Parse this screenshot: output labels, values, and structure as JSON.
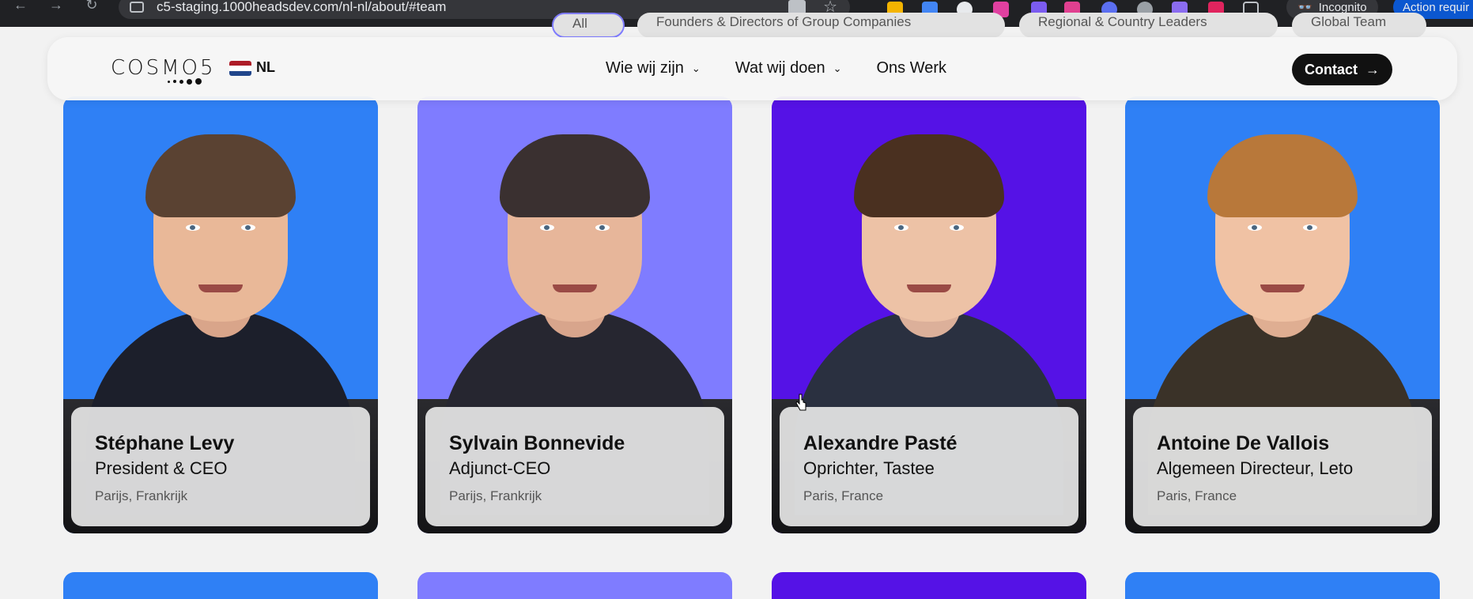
{
  "browser": {
    "url": "c5-staging.1000headsdev.com/nl-nl/about/#team",
    "incognito_label": "Incognito",
    "action_label": "Action requir",
    "back_icon": "arrow-left-icon",
    "forward_icon": "arrow-right-icon",
    "reload_icon": "reload-icon"
  },
  "filters": [
    {
      "label": "All"
    },
    {
      "label": "Founders & Directors of Group Companies"
    },
    {
      "label": "Regional & Country Leaders"
    },
    {
      "label": "Global Team"
    }
  ],
  "header": {
    "logo_text": "COSMO5",
    "lang": "NL",
    "nav": [
      {
        "label": "Wie wij zijn",
        "has_dropdown": true
      },
      {
        "label": "Wat wij doen",
        "has_dropdown": true
      },
      {
        "label": "Ons Werk",
        "has_dropdown": false
      }
    ],
    "contact_label": "Contact",
    "contact_icon": "arrow-right-icon"
  },
  "team": [
    {
      "name": "Stéphane Levy",
      "role": "President & CEO",
      "location": "Parijs, Frankrijk",
      "bg": "#2f80f5"
    },
    {
      "name": "Sylvain Bonnevide",
      "role": "Adjunct-CEO",
      "location": "Parijs, Frankrijk",
      "bg": "#7f7cff"
    },
    {
      "name": "Alexandre Pasté",
      "role": "Oprichter, Tastee",
      "location": "Paris, France",
      "bg": "#5512e6"
    },
    {
      "name": "Antoine De Vallois",
      "role": "Algemeen Directeur, Leto",
      "location": "Paris, France",
      "bg": "#2f80f5"
    }
  ],
  "colors": {
    "page_bg": "#f2f2f2",
    "contact_bg": "#111111"
  }
}
